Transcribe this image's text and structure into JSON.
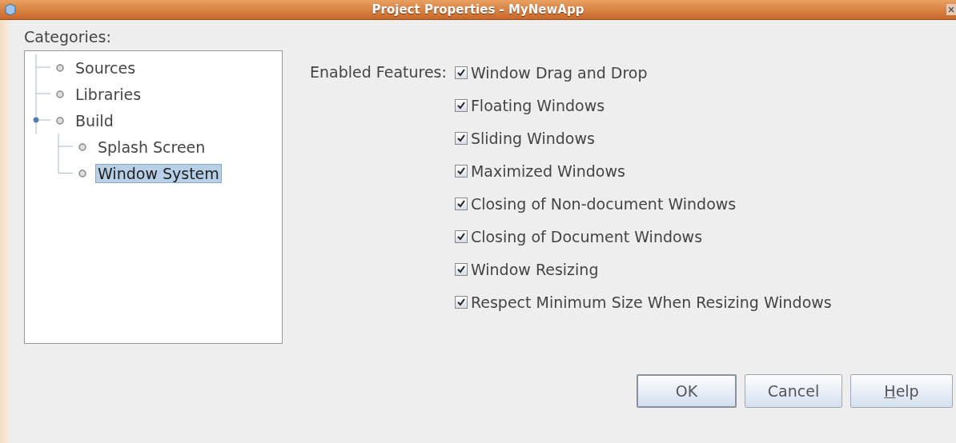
{
  "window": {
    "title": "Project Properties - MyNewApp"
  },
  "categories": {
    "label": "Categories:",
    "items": [
      {
        "label": "Sources",
        "selected": false
      },
      {
        "label": "Libraries",
        "selected": false
      },
      {
        "label": "Build",
        "selected": false,
        "expanded": true,
        "children": [
          {
            "label": "Splash Screen",
            "selected": false
          },
          {
            "label": "Window System",
            "selected": true
          }
        ]
      }
    ]
  },
  "features": {
    "label": "Enabled Features:",
    "options": [
      {
        "label": "Window Drag and Drop",
        "checked": true
      },
      {
        "label": "Floating Windows",
        "checked": true
      },
      {
        "label": "Sliding Windows",
        "checked": true
      },
      {
        "label": "Maximized Windows",
        "checked": true
      },
      {
        "label": "Closing of Non-document Windows",
        "checked": true
      },
      {
        "label": "Closing of Document Windows",
        "checked": true
      },
      {
        "label": "Window Resizing",
        "checked": true
      },
      {
        "label": "Respect Minimum Size When Resizing Windows",
        "checked": true
      }
    ]
  },
  "buttons": [
    {
      "label": "OK",
      "default": true,
      "mnemonic": false
    },
    {
      "label": "Cancel",
      "default": false,
      "mnemonic": false
    },
    {
      "label": "Help",
      "default": false,
      "mnemonic": true
    }
  ]
}
